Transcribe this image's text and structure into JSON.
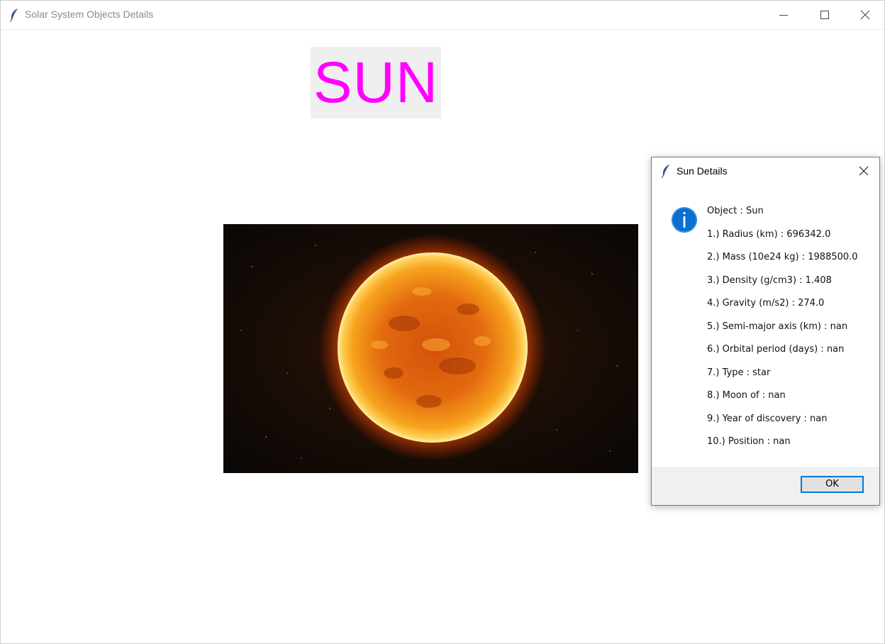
{
  "window": {
    "title": "Solar System Objects Details",
    "icon": "feather-icon",
    "controls": [
      "minimize-icon",
      "maximize-icon",
      "close-icon"
    ]
  },
  "main": {
    "heading": "SUN",
    "heading_color": "#ff00ff",
    "heading_bg": "#efefef",
    "image": "sun-photo"
  },
  "dialog": {
    "title": "Sun Details",
    "icon": "info-icon",
    "accent": "#0078d7",
    "lines": [
      "Object  :  Sun",
      "1.)  Radius (km)  :  696342.0",
      "2.)  Mass (10e24 kg)  :  1988500.0",
      "3.)  Density (g/cm3)  :  1.408",
      "4.)  Gravity (m/s2)  :  274.0",
      "5.)  Semi-major axis (km)  :  nan",
      "6.)  Orbital period (days)  :  nan",
      "7.)  Type  :  star",
      "8.)  Moon of  :  nan",
      "9.)  Year of discovery  :  nan",
      "10.)  Position  :  nan"
    ],
    "ok_label": "OK"
  }
}
